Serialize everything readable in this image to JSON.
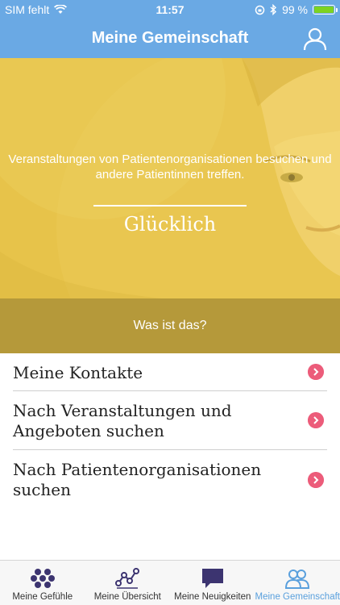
{
  "status": {
    "carrier": "SIM fehlt",
    "time": "11:57",
    "battery": "99 %",
    "battery_level": 0.99
  },
  "nav": {
    "title": "Meine Gemeinschaft"
  },
  "hero": {
    "description": "Veranstaltungen  von Patientenorganisationen besuchen und andere Patientinnen treffen.",
    "mood": "Glücklich",
    "what_label": "Was ist das?"
  },
  "list": [
    {
      "label": "Meine Kontakte"
    },
    {
      "label": "Nach Veranstaltungen und Angeboten suchen"
    },
    {
      "label": "Nach Patientenorganisationen suchen"
    }
  ],
  "tabs": [
    {
      "label": "Meine Gefühle"
    },
    {
      "label": "Meine Übersicht"
    },
    {
      "label": "Meine Neuigkeiten"
    },
    {
      "label": "Meine Gemeinschaft"
    }
  ],
  "colors": {
    "primary": "#6aa9e4",
    "hero": "#e7c34a",
    "accent": "#ec5c7a",
    "tab_icon": "#3c3470",
    "tab_active": "#5aa0dd"
  }
}
